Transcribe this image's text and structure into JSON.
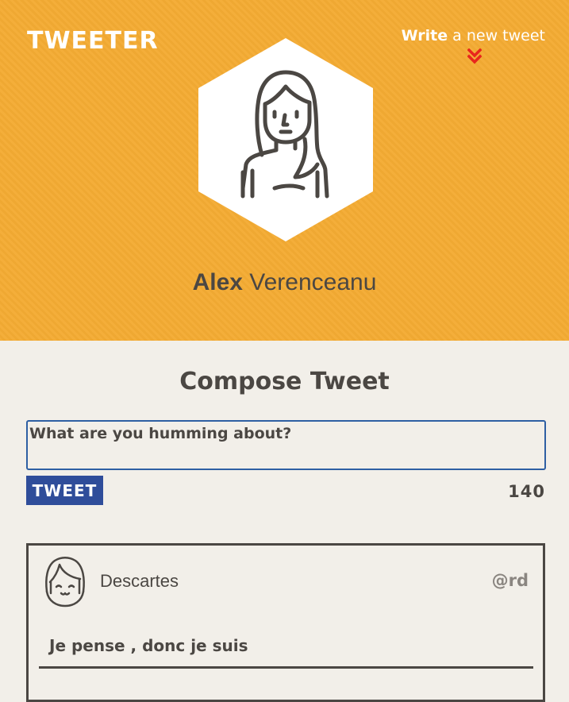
{
  "header": {
    "logo": "TWEETER",
    "write_link": {
      "bold": "Write",
      "rest": " a new tweet"
    },
    "chevron_icon": "double-chevron-down-icon",
    "avatar_icon": "woman-avatar-icon",
    "profile": {
      "first_name": "Alex",
      "last_name": " Verenceanu"
    }
  },
  "compose": {
    "title": "Compose Tweet",
    "input_placeholder": "What are you humming about?",
    "button_label": "TWEET",
    "char_count": "140"
  },
  "tweets": [
    {
      "avatar_icon": "girl-avatar-icon",
      "name": "Descartes",
      "handle": "@rd",
      "text": "Je pense , donc je suis"
    }
  ],
  "colors": {
    "header_bg": "#f4ab33",
    "page_bg": "#f2efe9",
    "text": "#4b4743",
    "button_bg": "#2f4d9a",
    "input_border": "#2e5fa3",
    "chevron": "#e8261c"
  }
}
